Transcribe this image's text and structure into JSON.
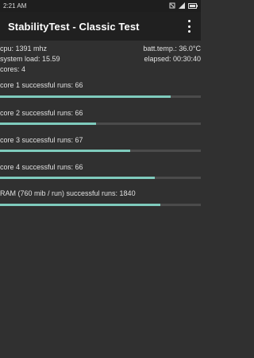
{
  "status_bar": {
    "time": "2:21 AM"
  },
  "app_bar": {
    "title": "StabilityTest - Classic Test",
    "menu_icon": "overflow-menu-icon"
  },
  "stats": {
    "cpu": "cpu: 1391 mhz",
    "batt_temp": "batt.temp.: 36.0°C",
    "system_load": "system load: 15.59",
    "elapsed": "elapsed: 00:30:40",
    "cores": "cores: 4"
  },
  "tests": [
    {
      "label": "core 1 successful runs: 66",
      "progress": 0.85
    },
    {
      "label": "core 2 successful runs: 66",
      "progress": 0.48
    },
    {
      "label": "core 3 successful runs: 67",
      "progress": 0.65
    },
    {
      "label": "core 4 successful runs: 66",
      "progress": 0.77
    },
    {
      "label": "RAM (760 mib / run) successful runs: 1840",
      "progress": 0.8
    }
  ],
  "colors": {
    "progress_fill": "#7fcbbd",
    "progress_track": "#4b4b4b",
    "background": "#303030"
  }
}
